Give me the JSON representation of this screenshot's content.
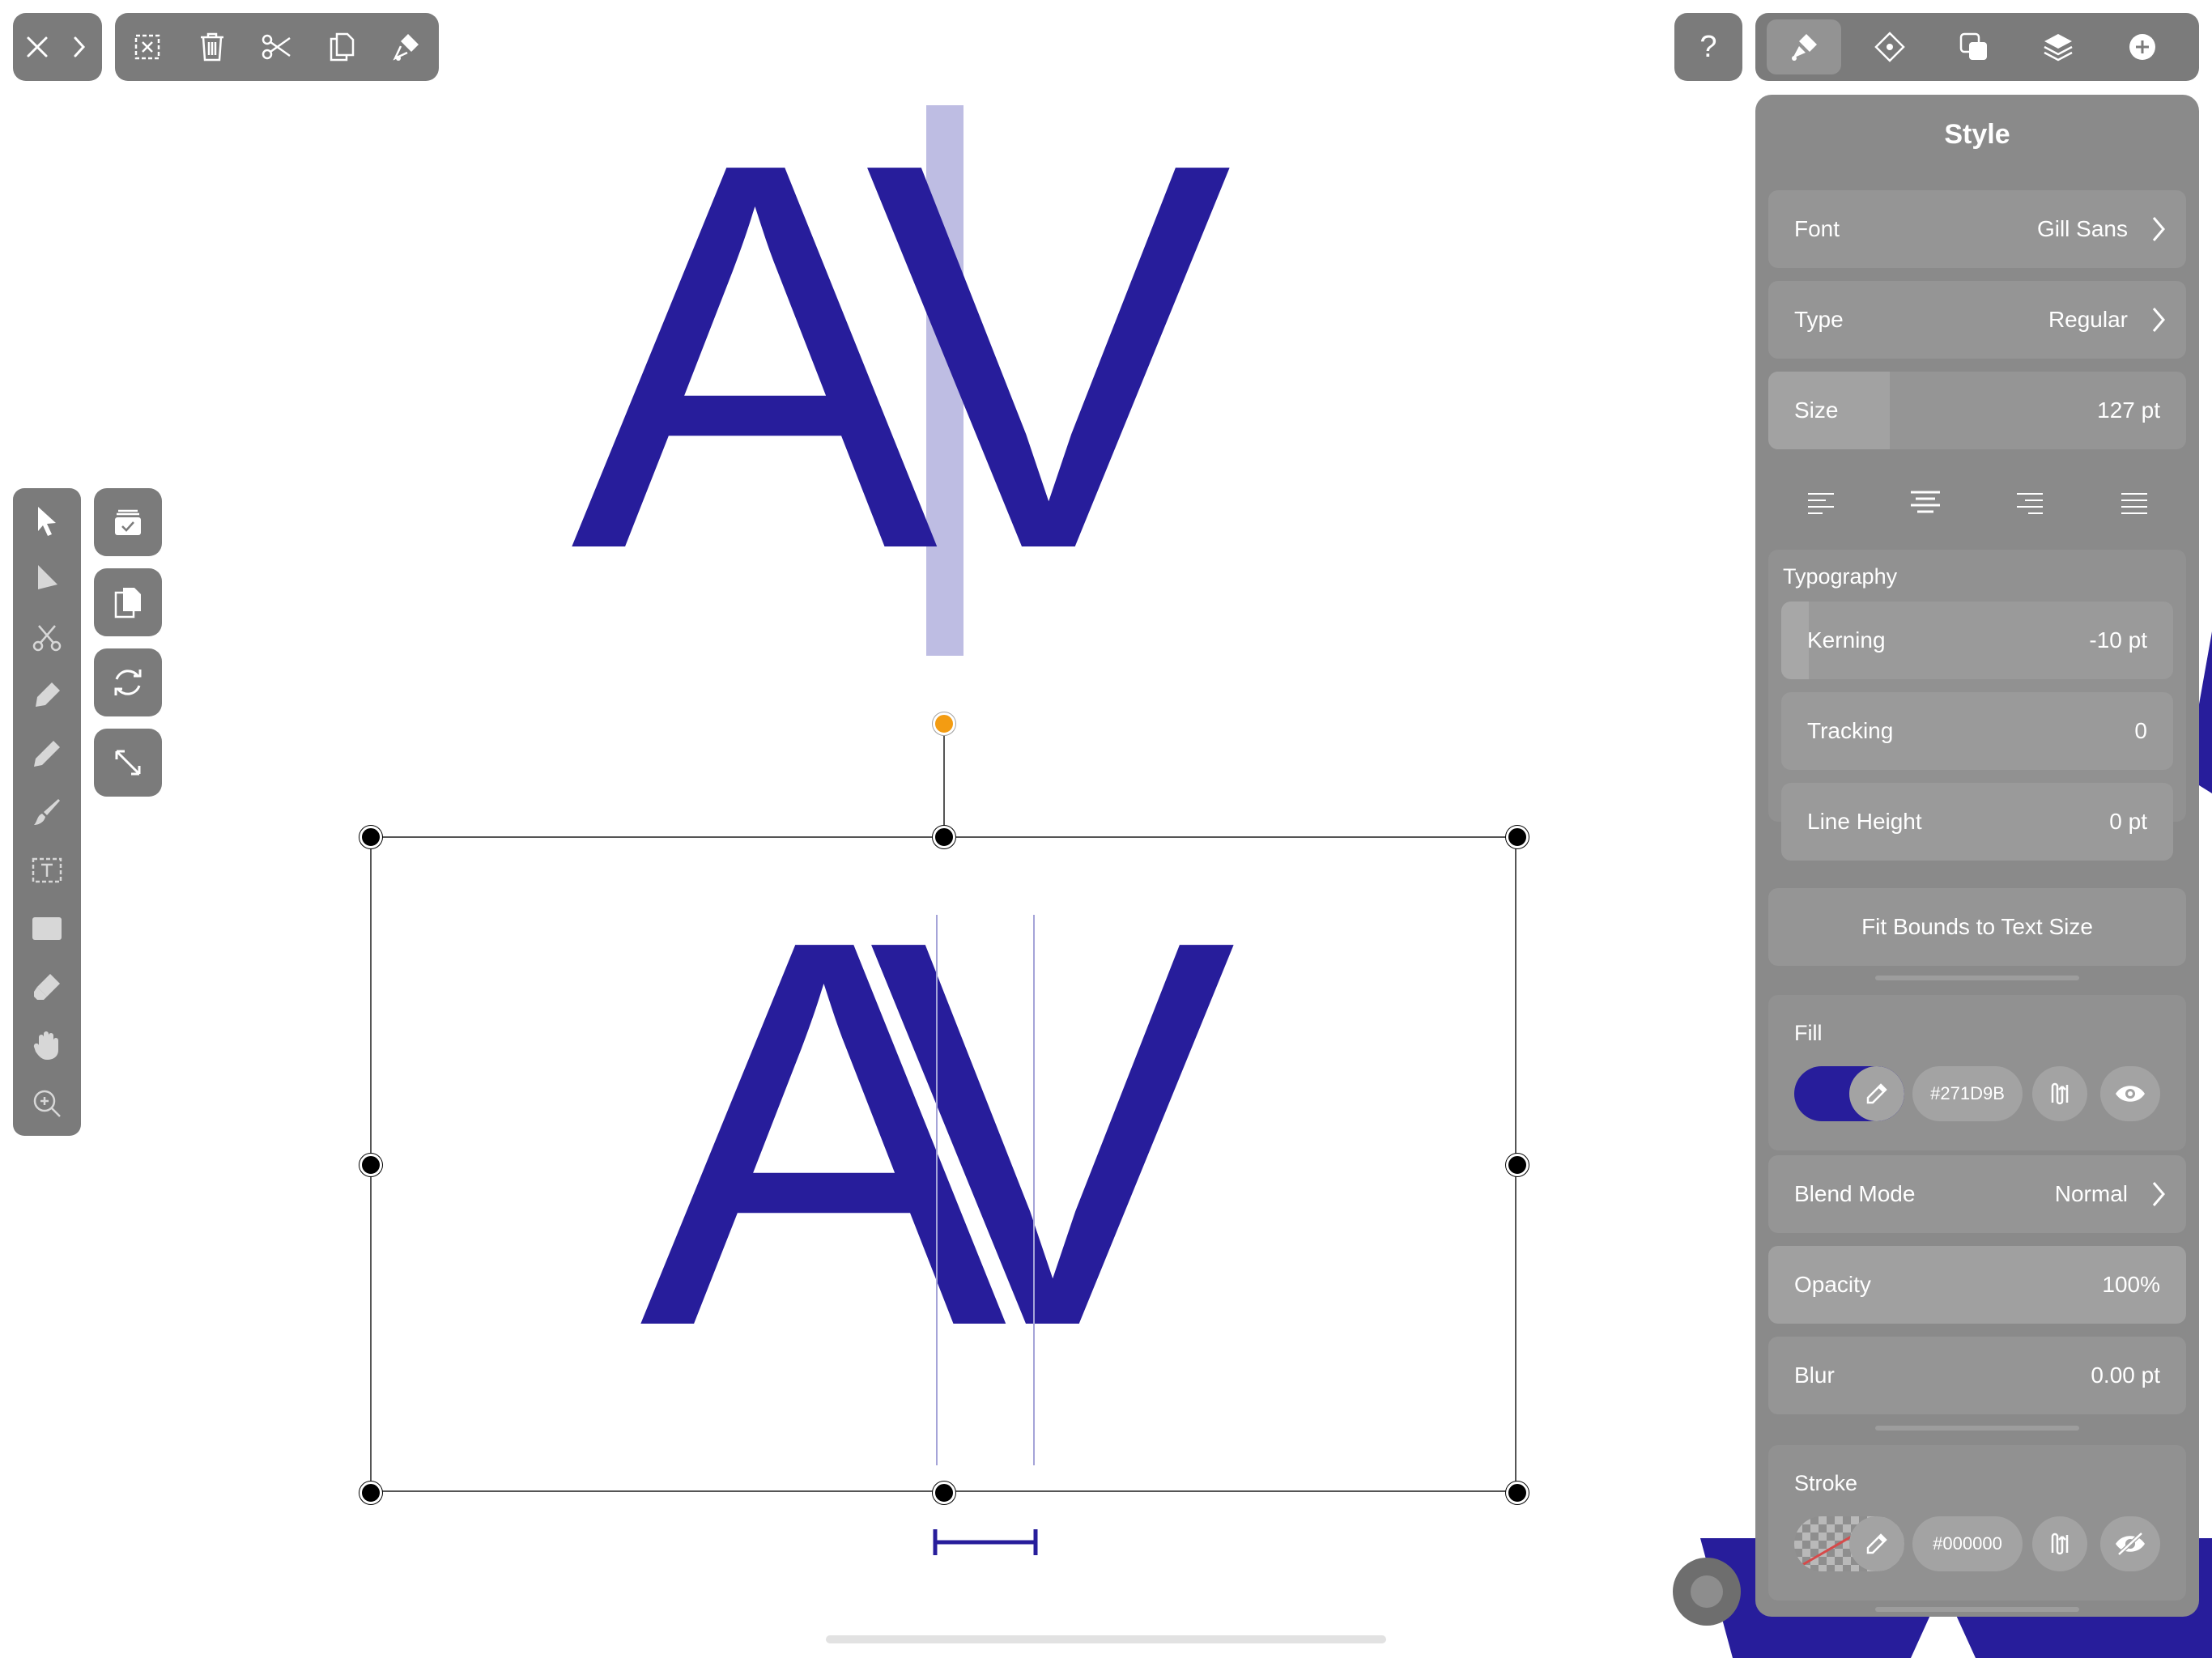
{
  "colors": {
    "accent": "#271D9B",
    "toolbar": "#7b7b7b",
    "panel": "#8a8a8a",
    "handle_rotate": "#f39c12"
  },
  "top_left_toolbar": {
    "icons": [
      "close-icon",
      "chevron-right-icon"
    ]
  },
  "edit_toolbar": {
    "icons": [
      "deselect-icon",
      "trash-icon",
      "scissors-icon",
      "copy-icon",
      "paste-style-icon"
    ]
  },
  "help": {
    "label": "?"
  },
  "tab_bar": {
    "tabs": [
      "brush-style-icon",
      "node-icon",
      "boolean-ops-icon",
      "layers-icon",
      "add-icon"
    ],
    "active": 0
  },
  "canvas": {
    "top_text": "AV",
    "bottom_text": "AV"
  },
  "style_panel": {
    "title": "Style",
    "font": {
      "label": "Font",
      "value": "Gill Sans"
    },
    "type": {
      "label": "Type",
      "value": "Regular"
    },
    "size": {
      "label": "Size",
      "value": "127 pt",
      "fill_fraction": 0.29
    },
    "alignment": {
      "options": [
        "align-left-icon",
        "align-center-icon",
        "align-right-icon",
        "align-justify-icon"
      ],
      "selected": "align-center-icon"
    },
    "typography": {
      "header": "Typography",
      "kerning": {
        "label": "Kerning",
        "value": "-10 pt"
      },
      "tracking": {
        "label": "Tracking",
        "value": "0"
      },
      "line_height": {
        "label": "Line Height",
        "value": "0 pt"
      }
    },
    "fit_bounds": "Fit Bounds to Text Size",
    "fill": {
      "header": "Fill",
      "hex": "#271D9B",
      "color": "#271D9B"
    },
    "blend_mode": {
      "label": "Blend Mode",
      "value": "Normal"
    },
    "opacity": {
      "label": "Opacity",
      "value": "100%"
    },
    "blur": {
      "label": "Blur",
      "value": "0.00 pt"
    },
    "stroke": {
      "header": "Stroke",
      "hex": "#000000"
    }
  }
}
